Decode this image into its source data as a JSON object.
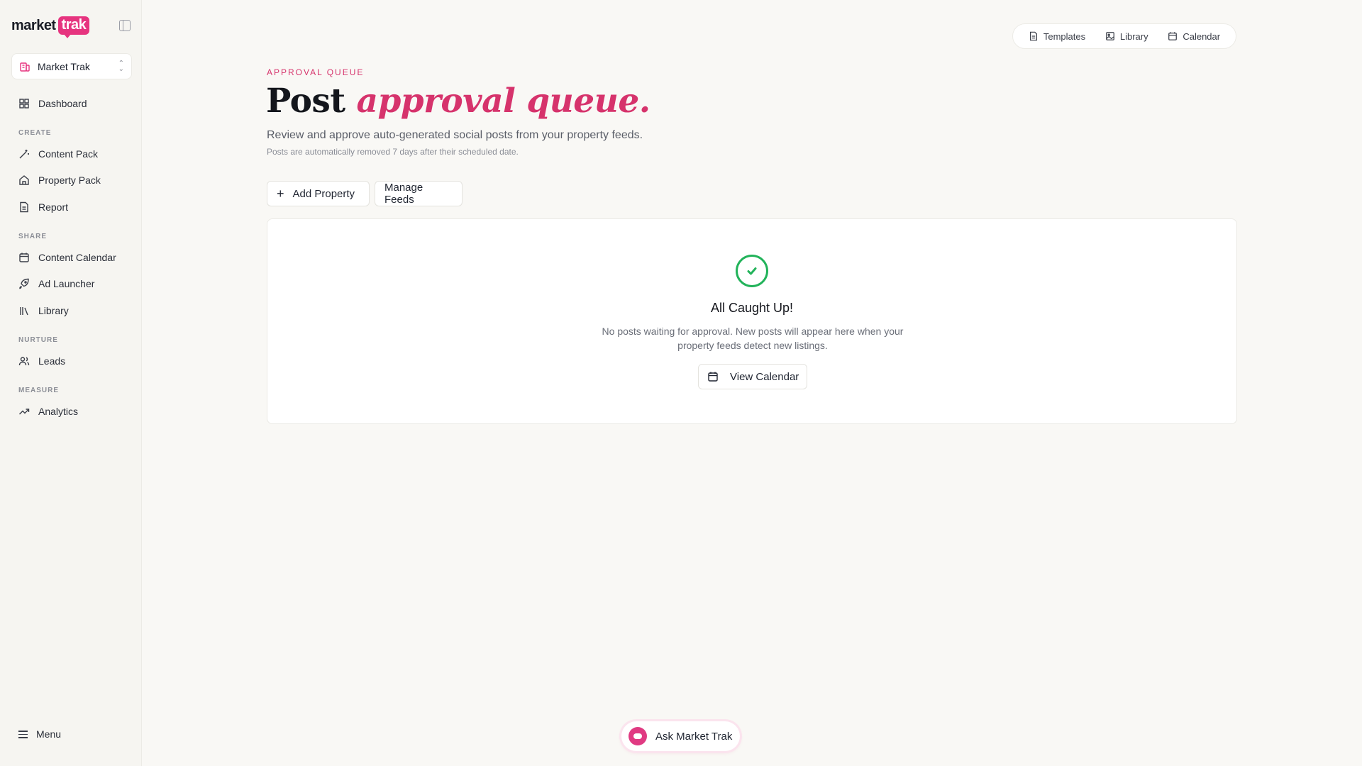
{
  "brand": {
    "logo_left": "market",
    "logo_right": "trak",
    "accent": "#e6347f"
  },
  "org_switcher": {
    "label": "Market Trak"
  },
  "sidebar": {
    "dashboard": "Dashboard",
    "sections": {
      "create": "CREATE",
      "share": "SHARE",
      "nurture": "NURTURE",
      "measure": "MEASURE"
    },
    "items": {
      "content_pack": "Content Pack",
      "property_pack": "Property Pack",
      "report": "Report",
      "content_calendar": "Content Calendar",
      "ad_launcher": "Ad Launcher",
      "library": "Library",
      "leads": "Leads",
      "analytics": "Analytics"
    },
    "menu": "Menu"
  },
  "top_nav": {
    "templates": "Templates",
    "library": "Library",
    "calendar": "Calendar"
  },
  "page": {
    "eyebrow": "APPROVAL QUEUE",
    "title_plain": "Post",
    "title_accent": "approval queue.",
    "subtitle": "Review and approve auto-generated social posts from your property feeds.",
    "note": "Posts are automatically removed 7 days after their scheduled date."
  },
  "actions": {
    "add_property": "Add Property",
    "manage_feeds": "Manage Feeds"
  },
  "empty_state": {
    "title": "All Caught Up!",
    "text": "No posts waiting for approval. New posts will appear here when your property feeds detect new listings.",
    "button": "View Calendar",
    "success_color": "#22b35a"
  },
  "assistant": {
    "label": "Ask Market Trak"
  }
}
